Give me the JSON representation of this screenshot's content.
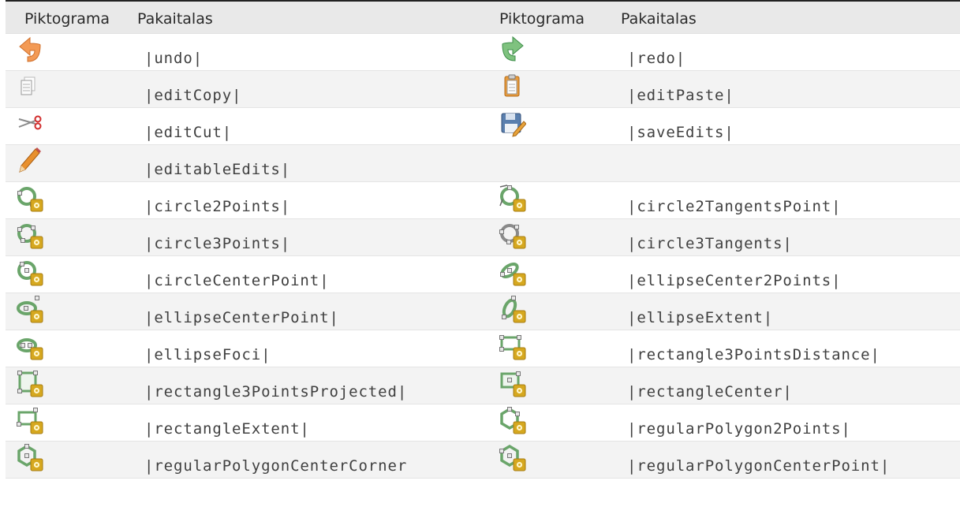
{
  "table": {
    "headers": {
      "icon": "Piktograma",
      "substitution": "Pakaitalas"
    },
    "rows": [
      {
        "left": {
          "icon": "undo-icon",
          "text": "|undo|"
        },
        "right": {
          "icon": "redo-icon",
          "text": "|redo|"
        }
      },
      {
        "left": {
          "icon": "edit-copy-icon",
          "text": "|editCopy|"
        },
        "right": {
          "icon": "edit-paste-icon",
          "text": "|editPaste|"
        }
      },
      {
        "left": {
          "icon": "edit-cut-icon",
          "text": "|editCut|"
        },
        "right": {
          "icon": "save-edits-icon",
          "text": "|saveEdits|"
        }
      },
      {
        "left": {
          "icon": "editable-edits-icon",
          "text": "|editableEdits|"
        },
        "right": {
          "icon": "",
          "text": ""
        }
      },
      {
        "left": {
          "icon": "circle-2-points-icon",
          "text": "|circle2Points|"
        },
        "right": {
          "icon": "circle-2-tangents-point-icon",
          "text": "|circle2TangentsPoint|"
        }
      },
      {
        "left": {
          "icon": "circle-3-points-icon",
          "text": "|circle3Points|"
        },
        "right": {
          "icon": "circle-3-tangents-icon",
          "text": "|circle3Tangents|"
        }
      },
      {
        "left": {
          "icon": "circle-center-point-icon",
          "text": "|circleCenterPoint|"
        },
        "right": {
          "icon": "ellipse-center-2-points-icon",
          "text": "|ellipseCenter2Points|"
        }
      },
      {
        "left": {
          "icon": "ellipse-center-point-icon",
          "text": "|ellipseCenterPoint|"
        },
        "right": {
          "icon": "ellipse-extent-icon",
          "text": "|ellipseExtent|"
        }
      },
      {
        "left": {
          "icon": "ellipse-foci-icon",
          "text": "|ellipseFoci|"
        },
        "right": {
          "icon": "rectangle-3-points-distance-icon",
          "text": "|rectangle3PointsDistance|"
        }
      },
      {
        "left": {
          "icon": "rectangle-3-points-projected-icon",
          "text": "|rectangle3PointsProjected|"
        },
        "right": {
          "icon": "rectangle-center-icon",
          "text": "|rectangleCenter|"
        }
      },
      {
        "left": {
          "icon": "rectangle-extent-icon",
          "text": "|rectangleExtent|"
        },
        "right": {
          "icon": "regular-polygon-2-points-icon",
          "text": "|regularPolygon2Points|"
        }
      },
      {
        "left": {
          "icon": "regular-polygon-center-corner-icon",
          "text": "|regularPolygonCenterCorner"
        },
        "right": {
          "icon": "regular-polygon-center-point-icon",
          "text": "|regularPolygonCenterPoint|"
        }
      }
    ]
  }
}
